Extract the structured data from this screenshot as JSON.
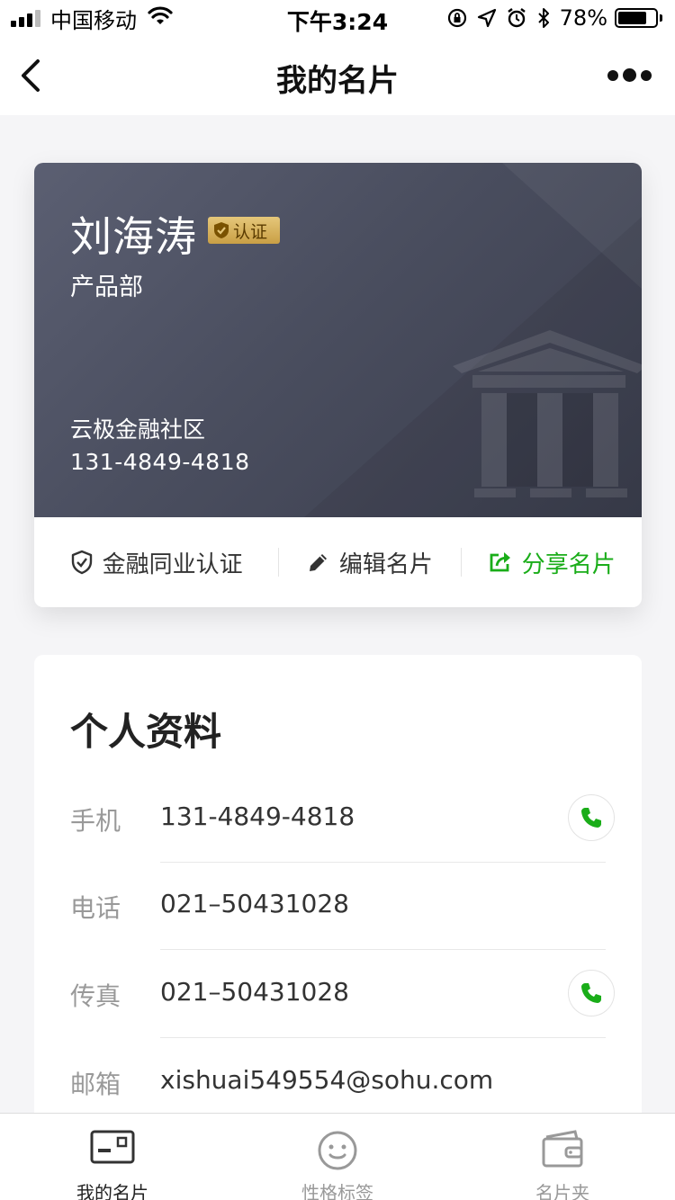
{
  "status_bar": {
    "carrier": "中国移动",
    "time": "下午3:24",
    "battery_percent": "78%",
    "battery_level": 0.78
  },
  "nav": {
    "title": "我的名片",
    "back_icon": "chevron-left-icon",
    "more_icon": "more-dots-icon"
  },
  "card": {
    "name": "刘海涛",
    "verified_label": "认证",
    "department": "产品部",
    "company": "云极金融社区",
    "phone": "131-4849-4818",
    "actions": [
      {
        "label": "金融同业认证",
        "icon": "shield-check-icon"
      },
      {
        "label": "编辑名片",
        "icon": "pencil-icon"
      },
      {
        "label": "分享名片",
        "icon": "share-icon",
        "color": "#1aad19"
      }
    ]
  },
  "profile": {
    "title": "个人资料",
    "rows": [
      {
        "label": "手机",
        "value": "131-4849-4818",
        "has_call": true
      },
      {
        "label": "电话",
        "value": "021–50431028",
        "has_call": false
      },
      {
        "label": "传真",
        "value": "021–50431028",
        "has_call": true
      },
      {
        "label": "邮箱",
        "value": "xishuai549554@sohu.com",
        "has_call": false
      }
    ]
  },
  "tabs": [
    {
      "label": "我的名片",
      "icon": "card-icon",
      "active": true
    },
    {
      "label": "性格标签",
      "icon": "smiley-icon",
      "active": false
    },
    {
      "label": "名片夹",
      "icon": "wallet-icon",
      "active": false
    }
  ],
  "colors": {
    "accent_green": "#1aad19",
    "badge_gold": "#d4ad55",
    "card_dark": "#4a4e5f"
  }
}
